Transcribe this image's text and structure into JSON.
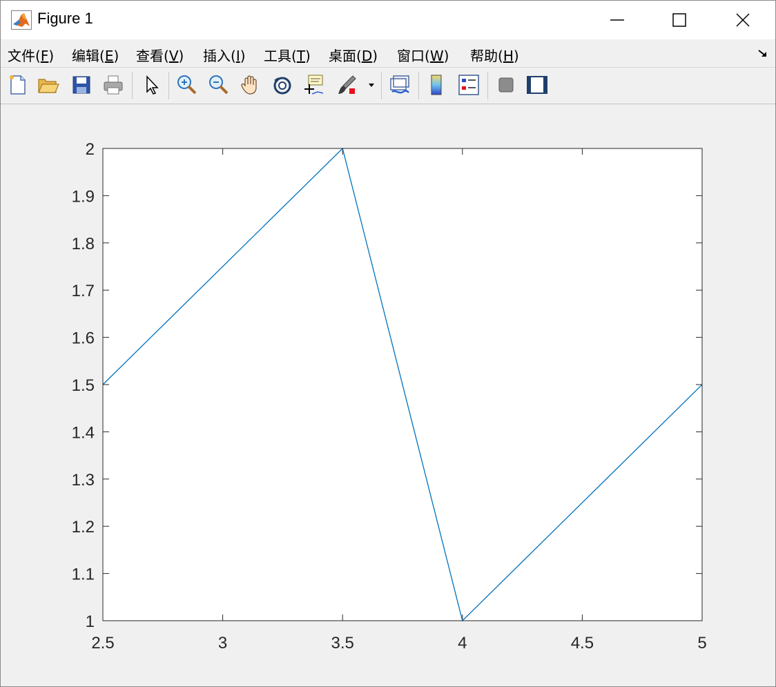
{
  "window": {
    "title": "Figure 1",
    "icons": {
      "app": "matlab-logo-icon",
      "minimize": "minimize-icon",
      "maximize": "maximize-icon",
      "close": "close-icon"
    }
  },
  "menubar": {
    "items": [
      {
        "label": "文件(",
        "key": "F",
        "end": ")"
      },
      {
        "label": "编辑(",
        "key": "E",
        "end": ")"
      },
      {
        "label": "查看(",
        "key": "V",
        "end": ")"
      },
      {
        "label": "插入(",
        "key": "I",
        "end": ")"
      },
      {
        "label": "工具(",
        "key": "T",
        "end": ")"
      },
      {
        "label": "桌面(",
        "key": "D",
        "end": ")"
      },
      {
        "label": "窗口(",
        "key": "W",
        "end": ")"
      },
      {
        "label": "帮助(",
        "key": "H",
        "end": ")"
      }
    ],
    "dock_icon": "dock-arrow-icon"
  },
  "toolbar": {
    "buttons": [
      "new-figure-icon",
      "open-file-icon",
      "save-icon",
      "print-icon",
      "edit-plot-arrow-icon",
      "zoom-in-icon",
      "zoom-out-icon",
      "pan-hand-icon",
      "rotate-3d-icon",
      "data-cursor-icon",
      "brush-icon",
      "link-plot-icon",
      "colorbar-icon",
      "legend-icon",
      "hide-plot-tools-icon",
      "show-plot-tools-icon"
    ]
  },
  "colors": {
    "line": "#0072bd",
    "axes_text": "#262626",
    "figure_bg": "#f0f0f0"
  },
  "chart_data": {
    "type": "line",
    "x": [
      2.5,
      3.5,
      4,
      5
    ],
    "series": [
      {
        "values": [
          1.5,
          2,
          1,
          1.5
        ]
      }
    ],
    "xlim": [
      2.5,
      5
    ],
    "ylim": [
      1,
      2
    ],
    "xticks": [
      2.5,
      3,
      3.5,
      4,
      4.5,
      5
    ],
    "xtick_labels": [
      "2.5",
      "3",
      "3.5",
      "4",
      "4.5",
      "5"
    ],
    "yticks": [
      1,
      1.1,
      1.2,
      1.3,
      1.4,
      1.5,
      1.6,
      1.7,
      1.8,
      1.9,
      2
    ],
    "ytick_labels": [
      "1",
      "1.1",
      "1.2",
      "1.3",
      "1.4",
      "1.5",
      "1.6",
      "1.7",
      "1.8",
      "1.9",
      "2"
    ],
    "title": "",
    "xlabel": "",
    "ylabel": "",
    "grid": false,
    "legend": "none"
  }
}
